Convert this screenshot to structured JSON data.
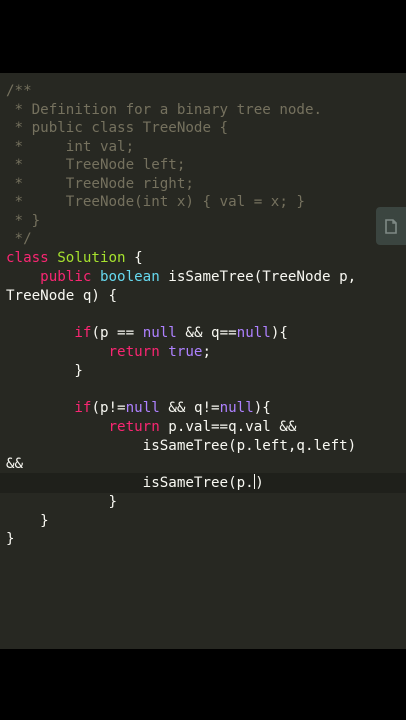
{
  "editor": {
    "colors": {
      "background": "#272822",
      "text": "#f8f8f2",
      "comment": "#75715e",
      "keyword": "#f92672",
      "type": "#66d9ef",
      "class_name": "#a6e22e",
      "literal": "#ae81ff"
    },
    "comment": {
      "l1": "/**",
      "l2": " * Definition for a binary tree node.",
      "l3": " * public class TreeNode {",
      "l4": " *     int val;",
      "l5": " *     TreeNode left;",
      "l6": " *     TreeNode right;",
      "l7": " *     TreeNode(int x) { val = x; }",
      "l8": " * }",
      "l9": " */"
    },
    "code": {
      "class_kw": "class",
      "class_name": "Solution",
      "brace_open": " {",
      "indent1": "    ",
      "public_kw": "public",
      "boolean_kw": "boolean",
      "method_sig": " isSameTree(TreeNode p,",
      "params_cont": "TreeNode q) {",
      "indent2": "        ",
      "if_kw": "if",
      "cond1_a": "(p == ",
      "null_kw": "null",
      "cond1_b": " && q==",
      "cond1_c": "){",
      "indent3": "            ",
      "return_kw": "return",
      "true_kw": "true",
      "semicolon": ";",
      "close_brace": "}",
      "cond2_a": "(p!=",
      "cond2_b": " && q!=",
      "return_expr": " p.val==q.val &&",
      "indent4": "                ",
      "call_left": "isSameTree(p.left,q.left)",
      "and_op": "&&",
      "call_partial": "isSameTree(p.",
      "auto_paren": ")",
      "indent_close": "    "
    }
  },
  "side_button": {
    "icon": "copy-icon"
  }
}
